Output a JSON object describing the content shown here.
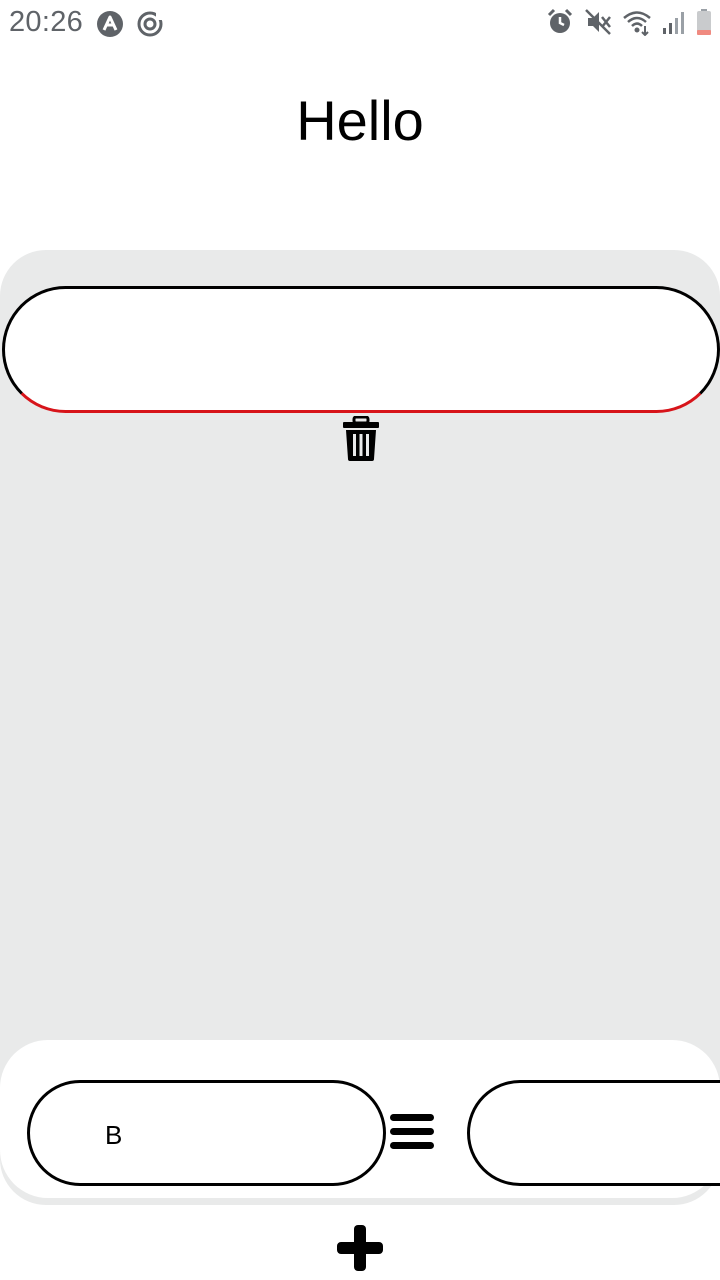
{
  "status_bar": {
    "time": "20:26",
    "left_icons": [
      "app-notification-icon",
      "sync-notification-icon"
    ],
    "right_icons": [
      "alarm-icon",
      "mute-icon",
      "wifi-icon",
      "signal-icon",
      "battery-icon"
    ]
  },
  "header": {
    "title": "Hello"
  },
  "main": {
    "item_input": {
      "value": "",
      "placeholder": ""
    },
    "delete_icon": "trash-icon"
  },
  "bottom_bar": {
    "left_field_label": "B",
    "menu_icon": "hamburger-menu-icon",
    "right_field_label": ""
  },
  "fab": {
    "icon": "plus-icon"
  },
  "colors": {
    "panel_background": "#e9eaea",
    "input_error_underline": "#d7141a",
    "status_text": "#5f6368"
  }
}
